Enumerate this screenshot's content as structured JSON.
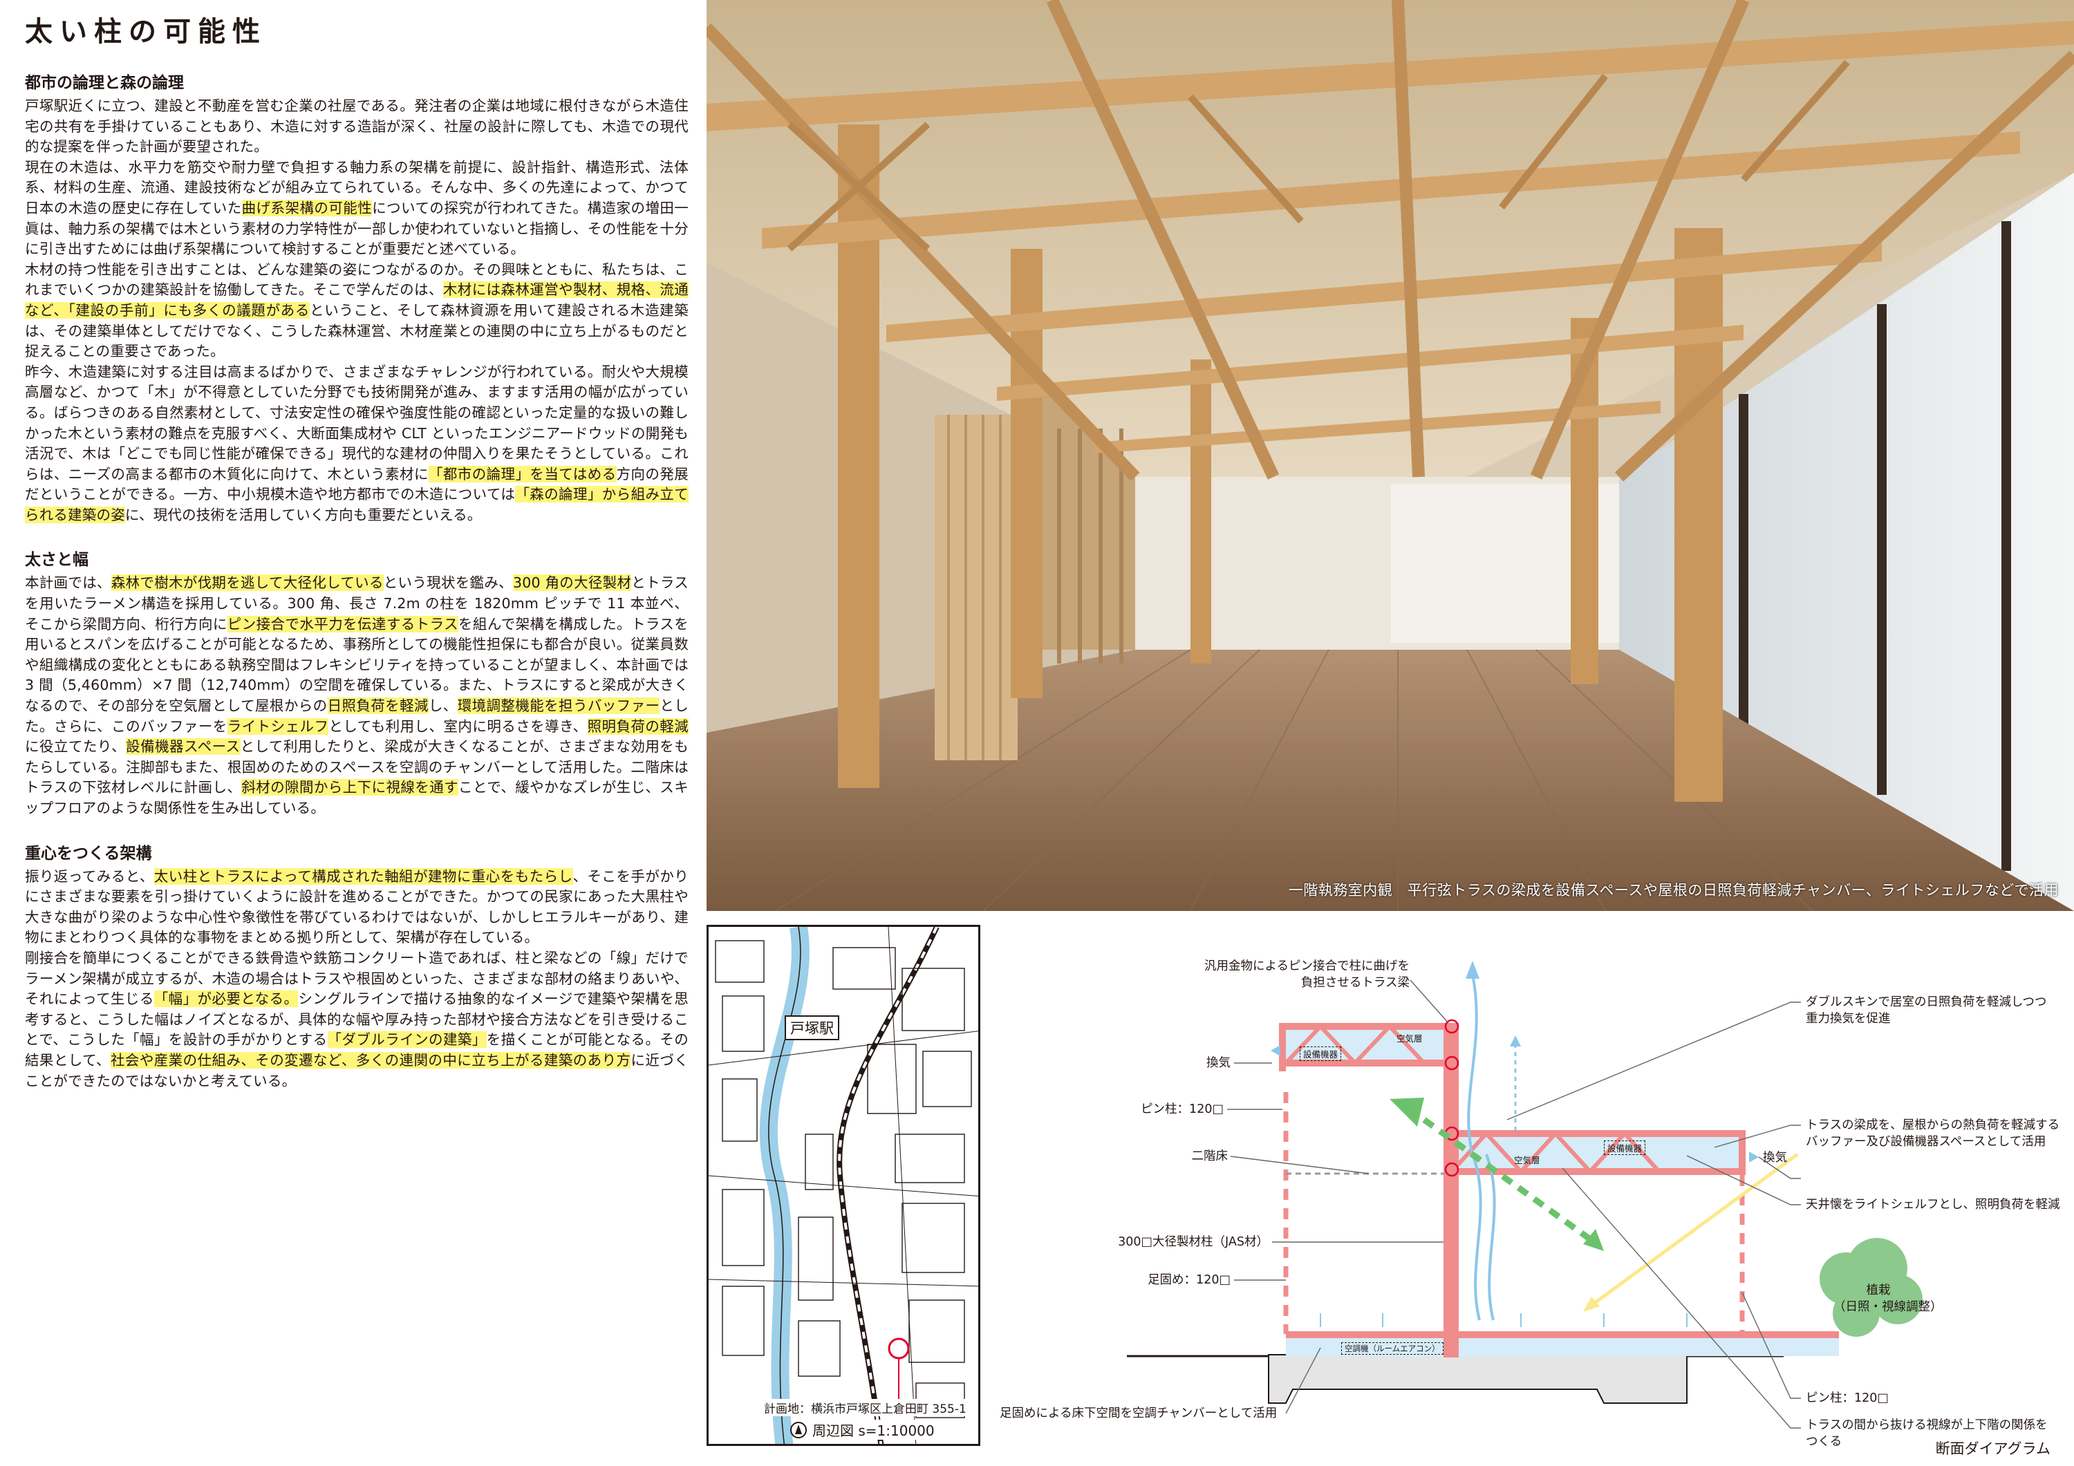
{
  "title": "太い柱の可能性",
  "sections": [
    {
      "heading": "都市の論理と森の論理",
      "paragraphs": [
        [
          {
            "t": "戸塚駅近くに立つ、建設と不動産を営む企業の社屋である。発注者の企業は地域に根付きながら木造住宅の共有を手掛けていることもあり、木造に対する造詣が深く、社屋の設計に際しても、木造での現代的な提案を伴った計画が要望された。"
          }
        ],
        [
          {
            "t": "現在の木造は、水平力を筋交や耐力壁で負担する軸力系の架構を前提に、設計指針、構造形式、法体系、材料の生産、流通、建設技術などが組み立てられている。そんな中、多くの先達によって、かつて日本の木造の歴史に存在していた"
          },
          {
            "t": "曲げ系架構の可能性",
            "hl": true
          },
          {
            "t": "についての探究が行われてきた。構造家の増田一眞は、軸力系の架構では木という素材の力学特性が一部しか使われていないと指摘し、その性能を十分に引き出すためには曲げ系架構について検討することが重要だと述べている。"
          }
        ],
        [
          {
            "t": "木材の持つ性能を引き出すことは、どんな建築の姿につながるのか。その興味とともに、私たちは、これまでいくつかの建築設計を協働してきた。そこで学んだのは、"
          },
          {
            "t": "木材には森林運営や製材、規格、流通など、「建設の手前」にも多くの議題がある",
            "hl": true
          },
          {
            "t": "ということ、そして森林資源を用いて建設される木造建築は、その建築単体としてだけでなく、こうした森林運営、木材産業との連関の中に立ち上がるものだと捉えることの重要さであった。"
          }
        ],
        [
          {
            "t": "昨今、木造建築に対する注目は高まるばかりで、さまざまなチャレンジが行われている。耐火や大規模高層など、かつて「木」が不得意としていた分野でも技術開発が進み、ますます活用の幅が広がっている。ばらつきのある自然素材として、寸法安定性の確保や強度性能の確認といった定量的な扱いの難しかった木という素材の難点を克服すべく、大断面集成材や CLT といったエンジニアードウッドの開発も活況で、木は「どこでも同じ性能が確保できる」現代的な建材の仲間入りを果たそうとしている。これらは、ニーズの高まる都市の木質化に向けて、木という素材に"
          },
          {
            "t": "「都市の論理」を当てはめる",
            "hl": true
          },
          {
            "t": "方向の発展だということができる。一方、中小規模木造や地方都市での木造については"
          },
          {
            "t": "「森の論理」から組み立てられる建築の姿",
            "hl": true
          },
          {
            "t": "に、現代の技術を活用していく方向も重要だといえる。"
          }
        ]
      ]
    },
    {
      "heading": "太さと幅",
      "paragraphs": [
        [
          {
            "t": "本計画では、"
          },
          {
            "t": "森林で樹木が伐期を逃して大径化している",
            "hl": true
          },
          {
            "t": "という現状を鑑み、"
          },
          {
            "t": "300 角の大径製材",
            "hl": true
          },
          {
            "t": "とトラスを用いたラーメン構造を採用している。300 角、長さ 7.2m の柱を 1820mm ピッチで 11 本並べ、そこから梁間方向、桁行方向に"
          },
          {
            "t": "ピン接合で水平力を伝達するトラス",
            "hl": true
          },
          {
            "t": "を組んで架構を構成した。トラスを用いるとスパンを広げることが可能となるため、事務所としての機能性担保にも都合が良い。従業員数や組織構成の変化とともにある執務空間はフレキシビリティを持っていることが望ましく、本計画では 3 間（5,460mm）×7 間（12,740mm）の空間を確保している。また、トラスにすると梁成が大きくなるので、その部分を空気層として屋根からの"
          },
          {
            "t": "日照負荷を軽減",
            "hl": true
          },
          {
            "t": "し、"
          },
          {
            "t": "環境調整機能を担うバッファー",
            "hl": true
          },
          {
            "t": "とした。さらに、このバッファーを"
          },
          {
            "t": "ライトシェルフ",
            "hl": true
          },
          {
            "t": "としても利用し、室内に明るさを導き、"
          },
          {
            "t": "照明負荷の軽減",
            "hl": true
          },
          {
            "t": "に役立てたり、"
          },
          {
            "t": "設備機器スペース",
            "hl": true
          },
          {
            "t": "として利用したりと、梁成が大きくなることが、さまざまな効用をもたらしている。注脚部もまた、根固めのためのスペースを空調のチャンバーとして活用した。二階床はトラスの下弦材レベルに計画し、"
          },
          {
            "t": "斜材の隙間から上下に視線を通す",
            "hl": true
          },
          {
            "t": "ことで、緩やかなズレが生じ、スキップフロアのような関係性を生み出している。"
          }
        ]
      ]
    },
    {
      "heading": "重心をつくる架構",
      "paragraphs": [
        [
          {
            "t": "振り返ってみると、"
          },
          {
            "t": "太い柱とトラスによって構成された軸組が建物に重心をもたらし",
            "hl": true
          },
          {
            "t": "、そこを手がかりにさまざまな要素を引っ掛けていくように設計を進めることができた。かつての民家にあった大黒柱や大きな曲がり梁のような中心性や象徴性を帯びているわけではないが、しかしヒエラルキーがあり、建物にまとわりつく具体的な事物をまとめる拠り所として、架構が存在している。"
          }
        ],
        [
          {
            "t": "剛接合を簡単につくることができる鉄骨造や鉄筋コンクリート造であれば、柱と梁などの「線」だけでラーメン架構が成立するが、木造の場合はトラスや根固めといった、さまざまな部材の絡まりあいや、それによって生じる"
          },
          {
            "t": "「幅」が必要となる。",
            "hl": true
          },
          {
            "t": "シングルラインで描ける抽象的なイメージで建築や架構を思考すると、こうした幅はノイズとなるが、具体的な幅や厚み持った部材や接合方法などを引き受けることで、こうした「幅」を設計の手がかりとする"
          },
          {
            "t": "「ダブルラインの建築」",
            "hl": true
          },
          {
            "t": "を描くことが可能となる。その結果として、"
          },
          {
            "t": "社会や産業の仕組み、その変遷など、多くの連関の中に立ち上がる建築のあり方",
            "hl": true
          },
          {
            "t": "に近づくことができたのではないかと考えている。"
          }
        ]
      ]
    }
  ],
  "photo": {
    "caption": "一階執務室内観　平行弦トラスの梁成を設備スペースや屋根の日照負荷軽減チャンバー、ライトシェルフなどで活用"
  },
  "map": {
    "station": "戸塚駅",
    "address": "計画地：横浜市戸塚区上倉田町 355-1",
    "scale": "周辺図 s=1:10000"
  },
  "diagram": {
    "title": "断面ダイアグラム",
    "annotations": {
      "pin_joint": "汎用金物によるピン接合で柱に曲げを\n負担させるトラス梁",
      "ventilation_left": "換気",
      "pin_column_top": "ピン柱：120□",
      "second_floor": "二階床",
      "large_column": "300□大径製材柱（JAS材）",
      "foot_tie": "足固め：120□",
      "underfloor": "足固めによる床下空間を空調チャンバーとして活用",
      "double_skin": "ダブルスキンで居室の日照負荷を軽減しつつ\n重力換気を促進",
      "truss_buffer": "トラスの梁成を、屋根からの熱負荷を軽減する\nバッファー及び設備機器スペースとして活用",
      "ventilation_right": "換気",
      "light_shelf": "天井懐をライトシェルフとし、照明負荷を軽減",
      "planting": "植栽\n（日照・視線調整）",
      "pin_column_bottom": "ピン柱：120□",
      "sightline": "トラスの間から抜ける視線が上下階の関係を\nつくる"
    },
    "inner_labels": {
      "air_upper": "空気層",
      "equip_upper": "設備機器",
      "air_mid": "空気層",
      "equip_mid": "設備機器",
      "ac_unit": "空調機（ルームエアコン）"
    }
  },
  "colors": {
    "highlight": "#fff57a",
    "frame": "#f08c8c",
    "air": "#d6ecf8",
    "light": "#fbe98a",
    "tree": "#8cc98c",
    "green_arrow": "#6cc26c"
  }
}
